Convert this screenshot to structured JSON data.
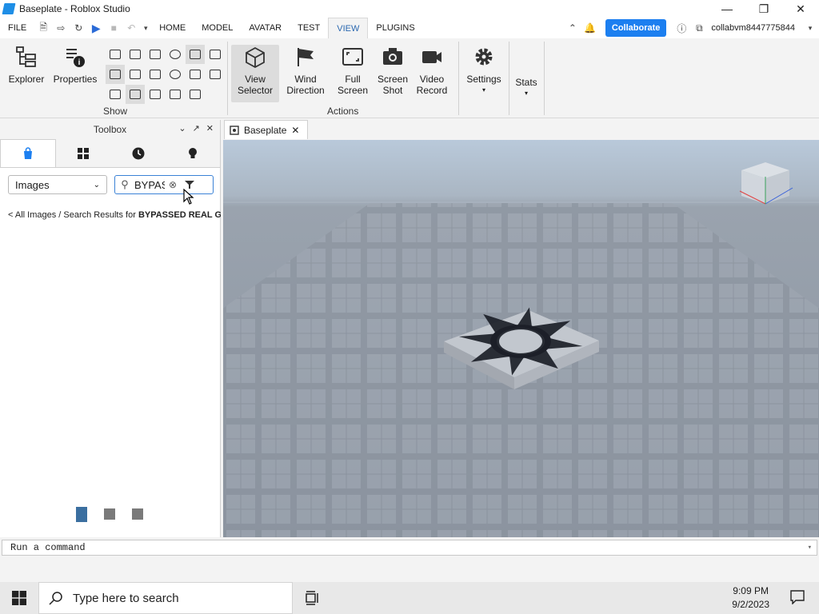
{
  "window": {
    "title": "Baseplate - Roblox Studio"
  },
  "menu": {
    "file": "FILE",
    "tabs": [
      "HOME",
      "MODEL",
      "AVATAR",
      "TEST",
      "VIEW",
      "PLUGINS"
    ],
    "collaborate": "Collaborate",
    "username": "collabvm8447775844"
  },
  "ribbon": {
    "explorer": "Explorer",
    "properties": "Properties",
    "show_group": "Show",
    "view_selector_1": "View",
    "view_selector_2": "Selector",
    "wind_1": "Wind",
    "wind_2": "Direction",
    "full_1": "Full",
    "full_2": "Screen",
    "shot_1": "Screen",
    "shot_2": "Shot",
    "video_1": "Video",
    "video_2": "Record",
    "actions_group": "Actions",
    "settings": "Settings",
    "stats": "Stats"
  },
  "toolbox": {
    "title": "Toolbox",
    "category": "Images",
    "search_value": "BYPASSED REAL GUI",
    "breadcrumb_prefix": "< All Images / Search Results for ",
    "breadcrumb_query": "BYPASSED REAL GUI"
  },
  "doc": {
    "tab": "Baseplate"
  },
  "command": {
    "placeholder": "Run a command"
  },
  "taskbar": {
    "search_placeholder": "Type here to search",
    "time": "9:09 PM",
    "date": "9/2/2023"
  }
}
